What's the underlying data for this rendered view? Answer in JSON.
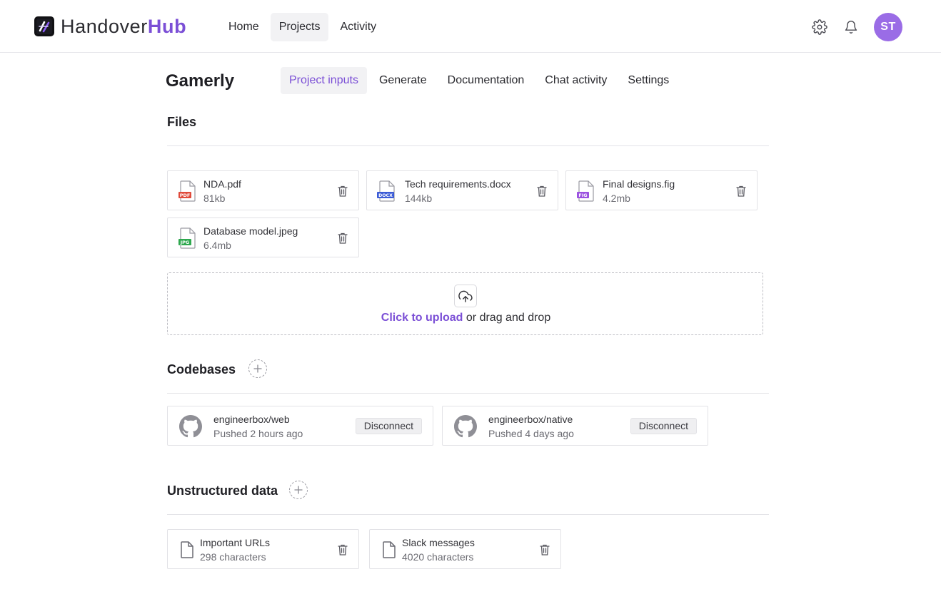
{
  "brand": {
    "name_part1": "Handover",
    "name_part2": "Hub"
  },
  "nav": {
    "items": [
      {
        "label": "Home",
        "active": false
      },
      {
        "label": "Projects",
        "active": true
      },
      {
        "label": "Activity",
        "active": false
      }
    ]
  },
  "header_icons": {
    "settings": "gear-icon",
    "notifications": "bell-icon"
  },
  "user": {
    "initials": "ST"
  },
  "colors": {
    "accent": "#7b4fd6",
    "avatar": "#9a6ce6",
    "pdf": "#e04a3b",
    "docx": "#3b5bd6",
    "fig": "#9b51e0",
    "jpg": "#2fa84f"
  },
  "project": {
    "title": "Gamerly",
    "tabs": [
      {
        "label": "Project inputs",
        "active": true
      },
      {
        "label": "Generate",
        "active": false
      },
      {
        "label": "Documentation",
        "active": false
      },
      {
        "label": "Chat activity",
        "active": false
      },
      {
        "label": "Settings",
        "active": false
      }
    ]
  },
  "files": {
    "title": "Files",
    "items": [
      {
        "name": "NDA.pdf",
        "size": "81kb",
        "type": "PDF"
      },
      {
        "name": "Tech requirements.docx",
        "size": "144kb",
        "type": "DOCX"
      },
      {
        "name": "Final designs.fig",
        "size": "4.2mb",
        "type": "FIG"
      },
      {
        "name": "Database model.jpeg",
        "size": "6.4mb",
        "type": "JPG"
      }
    ],
    "upload": {
      "link": "Click to upload",
      "rest": "or drag and drop"
    }
  },
  "codebases": {
    "title": "Codebases",
    "items": [
      {
        "name": "engineerbox/web",
        "status": "Pushed 2 hours ago",
        "action": "Disconnect"
      },
      {
        "name": "engineerbox/native",
        "status": "Pushed 4 days ago",
        "action": "Disconnect"
      }
    ]
  },
  "unstructured": {
    "title": "Unstructured data",
    "items": [
      {
        "name": "Important URLs",
        "size": "298 characters"
      },
      {
        "name": "Slack messages",
        "size": "4020 characters"
      }
    ]
  }
}
